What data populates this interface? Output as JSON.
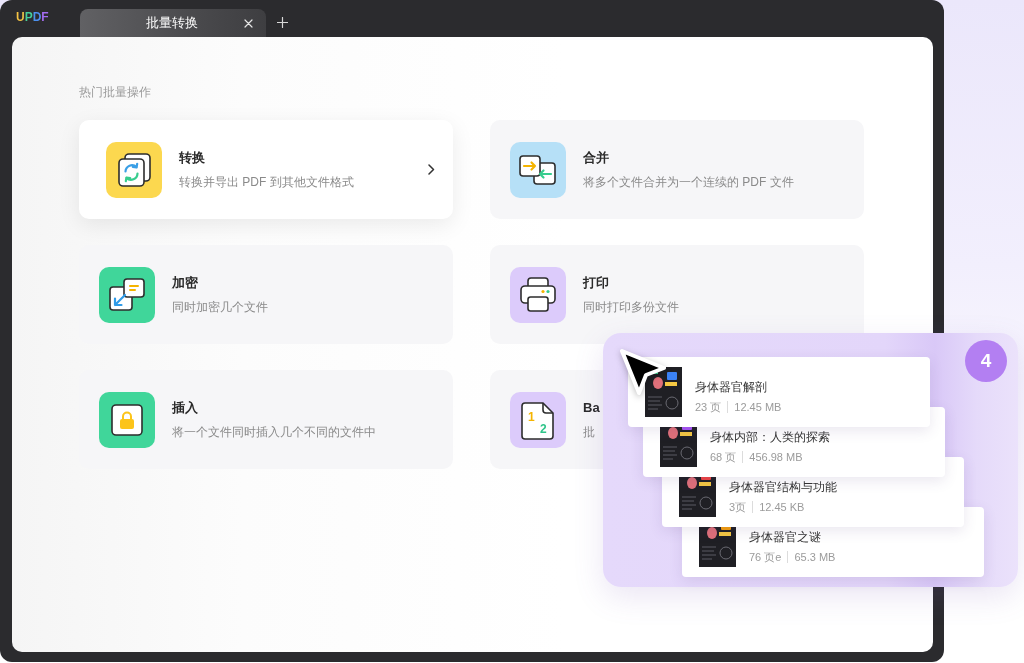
{
  "app": {
    "logo": "UPDF"
  },
  "tabs": [
    {
      "label": "批量转换",
      "selected": true
    }
  ],
  "section_title": "热门批量操作",
  "operations": [
    {
      "kind": "convert",
      "title": "转换",
      "description": "转换并导出 PDF 到其他文件格式",
      "hovered": true
    },
    {
      "kind": "merge",
      "title": "合并",
      "description": "将多个文件合并为一个连续的 PDF 文件",
      "hovered": false
    },
    {
      "kind": "encrypt",
      "title": "加密",
      "description": "同时加密几个文件",
      "hovered": false
    },
    {
      "kind": "print",
      "title": "打印",
      "description": "同时打印多份文件",
      "hovered": false
    },
    {
      "kind": "insert",
      "title": "插入",
      "description": "将一个文件同时插入几个不同的文件中",
      "hovered": false
    },
    {
      "kind": "pages",
      "title": "Ba",
      "description": "批",
      "hovered": false,
      "icon_labels": [
        "1",
        "2"
      ]
    }
  ],
  "drag_preview": {
    "count": "4",
    "files": [
      {
        "name": "身体器官解剖",
        "pages": "23 页",
        "size": "12.45 MB"
      },
      {
        "name": "身体内部：人类的探索",
        "pages": "68 页",
        "size": "456.98 MB"
      },
      {
        "name": "身体器官结构与功能",
        "pages": "3页",
        "size": "12.45 KB"
      },
      {
        "name": "身体器官之谜",
        "pages": "76 页e",
        "size": "65.3 MB"
      }
    ]
  }
}
